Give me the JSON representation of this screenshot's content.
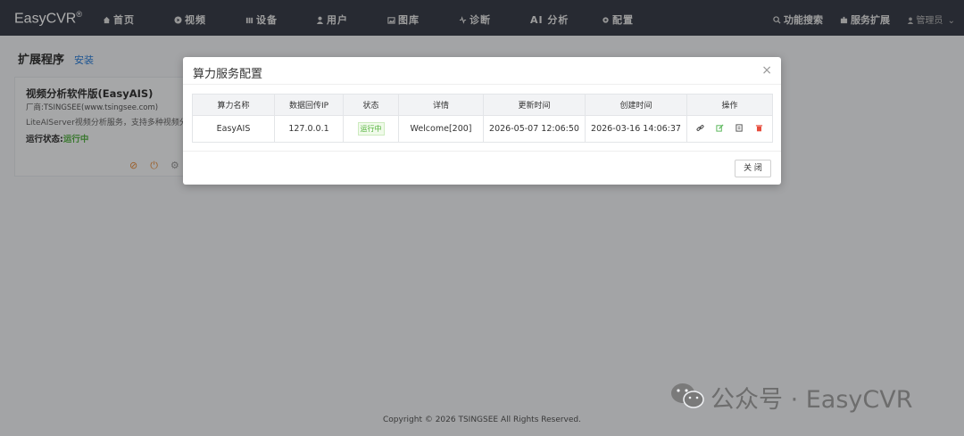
{
  "app": {
    "logo": "EasyCVR",
    "logo_mark": "®"
  },
  "nav": {
    "items": [
      {
        "label": "首页",
        "icon": "home-icon"
      },
      {
        "label": "视频",
        "icon": "play-icon"
      },
      {
        "label": "设备",
        "icon": "device-icon"
      },
      {
        "label": "用户",
        "icon": "user-icon"
      },
      {
        "label": "图库",
        "icon": "gallery-icon"
      },
      {
        "label": "诊断",
        "icon": "diagnose-icon"
      },
      {
        "label": "AI 分析",
        "icon": ""
      },
      {
        "label": "配置",
        "icon": "gear-icon"
      }
    ],
    "search": "功能搜索",
    "extensions": "服务扩展",
    "user": "管理员"
  },
  "page": {
    "title": "扩展程序",
    "install": "安装"
  },
  "extension_card": {
    "name": "视频分析软件版(EasyAIS)",
    "vendor": "厂商:TSINGSEE(www.tsingsee.com)",
    "description": "LiteAIServer视频分析服务，支持多种视频分析",
    "status_label": "运行状态:",
    "status_value": "运行中"
  },
  "modal": {
    "title": "算力服务配置",
    "close_icon": "×",
    "columns": [
      "算力名称",
      "数据回传IP",
      "状态",
      "详情",
      "更新时间",
      "创建时间",
      "操作"
    ],
    "rows": [
      {
        "name": "EasyAIS",
        "ip": "127.0.0.1",
        "status": "运行中",
        "detail": "Welcome[200]",
        "updated": "2026-05-07 12:06:50",
        "created": "2026-03-16 14:06:37"
      }
    ],
    "close_button": "关 闭"
  },
  "footer": {
    "copyright": "Copyright © 2026 TSINGSEE All Rights Reserved."
  },
  "watermark": {
    "text": "公众号 · EasyCVR"
  },
  "colors": {
    "nav_bg": "#3a3f4b",
    "accent_green": "#52b13b",
    "danger": "#e74c3c",
    "link": "#2f7fd8"
  }
}
